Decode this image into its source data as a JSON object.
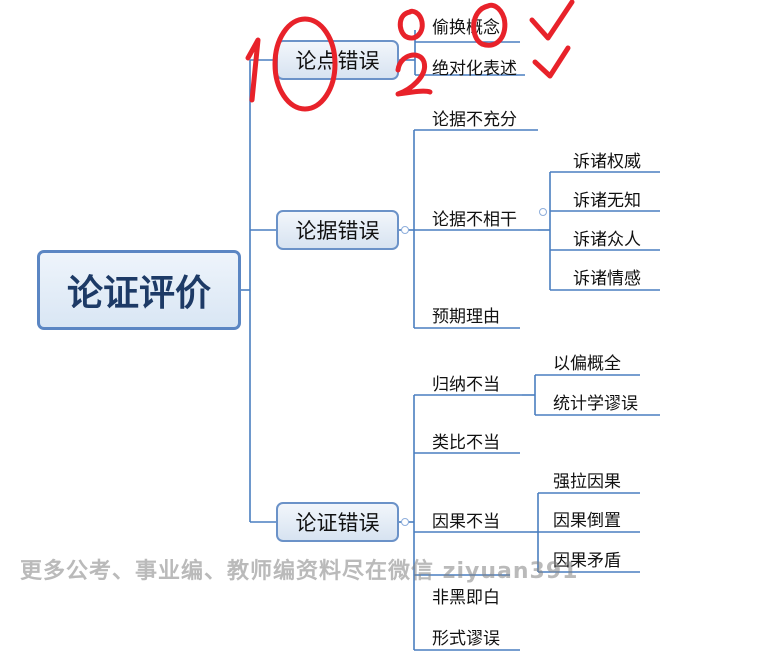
{
  "root": {
    "label": "论证评价"
  },
  "branches": {
    "b1": {
      "label": "论点错误",
      "children": [
        "偷换概念",
        "绝对化表述"
      ]
    },
    "b2": {
      "label": "论据错误",
      "c1": "论据不充分",
      "c2": {
        "label": "论据不相干",
        "children": [
          "诉诸权威",
          "诉诸无知",
          "诉诸众人",
          "诉诸情感"
        ]
      },
      "c3": "预期理由"
    },
    "b3": {
      "label": "论证错误",
      "c1": {
        "label": "归纳不当",
        "children": [
          "以偏概全",
          "统计学谬误"
        ]
      },
      "c2": "类比不当",
      "c3": {
        "label": "因果不当",
        "children": [
          "强拉因果",
          "因果倒置",
          "因果矛盾"
        ]
      },
      "c4": "非黑即白",
      "c5": "形式谬误"
    }
  },
  "watermark": "更多公考、事业编、教师编资料尽在微信 ziyuan391",
  "annotations": {
    "ink_color": "#e8222a",
    "line_color": "#4a7ec0"
  }
}
